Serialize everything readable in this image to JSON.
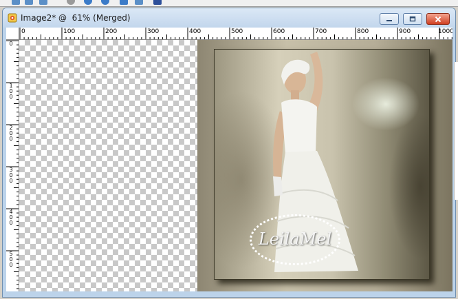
{
  "window": {
    "title": "Image2* @  61% (Merged)",
    "buttons": [
      "minimize",
      "restore",
      "close"
    ]
  },
  "icons": {
    "document": "psp-image-icon",
    "minimize": "minimize-icon",
    "restore": "restore-icon",
    "close": "close-icon"
  },
  "ruler": {
    "horizontal_labels": [
      "0",
      "100",
      "200",
      "300",
      "400",
      "500",
      "600",
      "700",
      "800",
      "900",
      "1000"
    ],
    "vertical_labels": [
      "0",
      "100",
      "200",
      "300",
      "400",
      "500"
    ]
  },
  "canvas": {
    "zoom": "61%",
    "transparency": "checkerboard"
  },
  "artwork": {
    "signature": "LeilaMel"
  },
  "colors": {
    "title_bar": "#c2d6ec",
    "close_button": "#cf3f22",
    "checker_dark": "#c8c8c8",
    "frame": "#c7c0a9"
  }
}
